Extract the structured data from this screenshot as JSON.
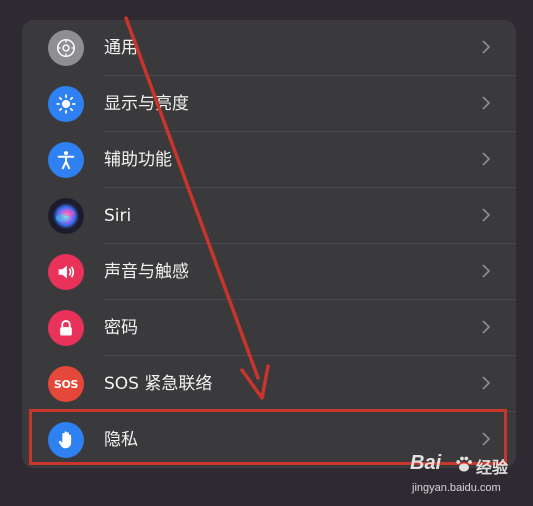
{
  "settings": {
    "items": [
      {
        "label": "通用",
        "icon": "gear-icon",
        "icon_color": "#8e8e93"
      },
      {
        "label": "显示与亮度",
        "icon": "sun-icon",
        "icon_color": "#2f80f0"
      },
      {
        "label": "辅助功能",
        "icon": "accessibility-icon",
        "icon_color": "#2f80f0"
      },
      {
        "label": "Siri",
        "icon": "siri-icon",
        "icon_color": "#1c1c2e"
      },
      {
        "label": "声音与触感",
        "icon": "speaker-icon",
        "icon_color": "#e8325a"
      },
      {
        "label": "密码",
        "icon": "lock-icon",
        "icon_color": "#e8325a"
      },
      {
        "label": "SOS 紧急联络",
        "icon": "sos-icon",
        "icon_color": "#e5483a",
        "icon_text": "SOS"
      },
      {
        "label": "隐私",
        "icon": "hand-icon",
        "icon_color": "#2f80f0"
      }
    ]
  },
  "annotation": {
    "color": "#c9342b"
  },
  "watermark": {
    "brand": "Bai",
    "jingyan": "经验",
    "url": "jingyan.baidu.com"
  }
}
